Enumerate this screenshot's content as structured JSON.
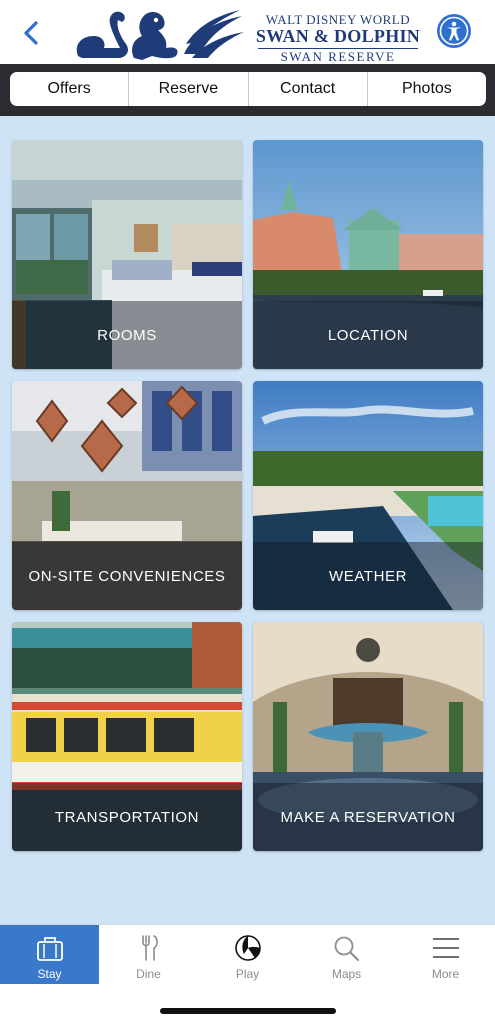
{
  "header": {
    "logo_line1": "WALT DISNEY WORLD",
    "logo_line2": "SWAN & DOLPHIN",
    "logo_line3": "SWAN RESERVE",
    "back_icon": "chevron-left-icon",
    "accessibility_icon": "accessibility-icon"
  },
  "nav": {
    "items": [
      "Offers",
      "Reserve",
      "Contact",
      "Photos"
    ]
  },
  "tiles": [
    {
      "label": "ROOMS"
    },
    {
      "label": "LOCATION"
    },
    {
      "label": "ON-SITE CONVENIENCES"
    },
    {
      "label": "WEATHER"
    },
    {
      "label": "TRANSPORTATION"
    },
    {
      "label": "MAKE A RESERVATION"
    }
  ],
  "tabbar": {
    "active": "Stay",
    "items": [
      {
        "label": "Stay",
        "icon": "suitcase-icon"
      },
      {
        "label": "Dine",
        "icon": "fork-knife-icon"
      },
      {
        "label": "Play",
        "icon": "beach-ball-icon"
      },
      {
        "label": "Maps",
        "icon": "search-icon"
      },
      {
        "label": "More",
        "icon": "menu-icon"
      }
    ]
  },
  "colors": {
    "brand_navy": "#1f3c78",
    "accent_blue": "#3a78c9",
    "content_bg": "#cfe3f7",
    "nav_bar_bg": "#2a2c31"
  }
}
